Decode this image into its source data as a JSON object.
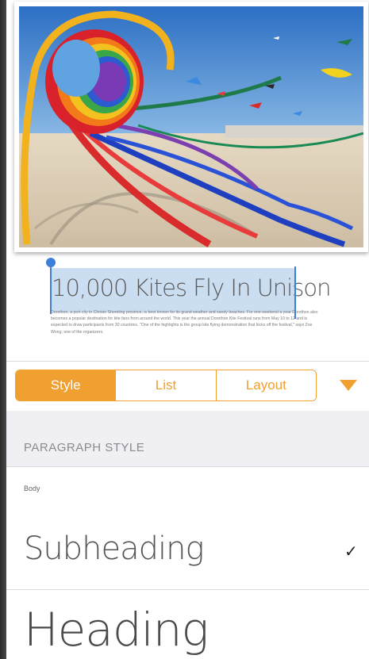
{
  "document": {
    "title": "10,000 Kites Fly In Unison",
    "body": "Dorothon, a port city in Christo Shoreling province, is best known for its grand weather and sandy beaches. For one weekend a year Dorothon also becomes a popular destination for kite fans from around the world. This year the annual Dorothon Kite Festival runs from May 10 to 12 and is expected to draw participants from 30 countries. \"One of the highlights is the group kite flying demonstration that kicks off the festival,\" says Zoe Wong, one of the organizers."
  },
  "tabs": {
    "items": [
      "Style",
      "List",
      "Layout"
    ],
    "active": "Style"
  },
  "paragraph_style": {
    "header": "PARAGRAPH STYLE",
    "options": [
      {
        "label": "Body",
        "selected": false
      },
      {
        "label": "Subheading",
        "selected": true
      },
      {
        "label": "Heading",
        "selected": false
      }
    ],
    "check_glyph": "✓"
  },
  "colors": {
    "accent": "#f0a030",
    "selection": "#3c7fd8"
  },
  "icons": {
    "expand": "triangle-down-icon"
  }
}
